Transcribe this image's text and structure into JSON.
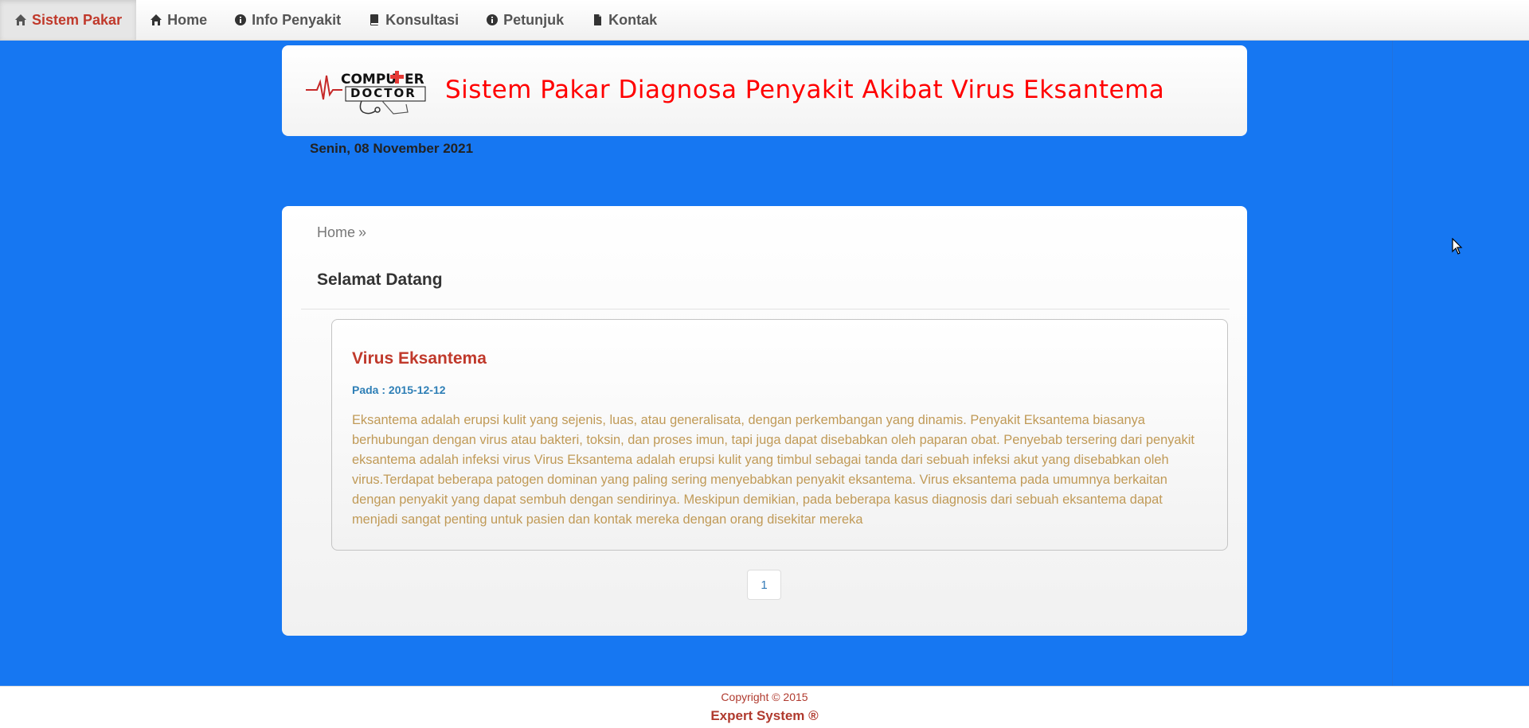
{
  "nav": {
    "brand": {
      "label": "Sistem Pakar",
      "icon": "home-icon"
    },
    "items": [
      {
        "label": "Home",
        "icon": "home-icon"
      },
      {
        "label": "Info Penyakit",
        "icon": "info-circle-icon"
      },
      {
        "label": "Konsultasi",
        "icon": "book-icon"
      },
      {
        "label": "Petunjuk",
        "icon": "info-circle-icon"
      },
      {
        "label": "Kontak",
        "icon": "file-icon"
      }
    ]
  },
  "header": {
    "logo_text": "COMPUTER DOCTOR",
    "title": "Sistem Pakar Diagnosa Penyakit Akibat Virus Eksantema"
  },
  "date": "Senin, 08 November 2021",
  "main": {
    "breadcrumb": {
      "home": "Home",
      "separator": "»"
    },
    "page_title": "Selamat Datang",
    "article": {
      "title": "Virus Eksantema",
      "date": "Pada : 2015-12-12",
      "body": "Eksantema adalah erupsi kulit yang sejenis, luas, atau generalisata, dengan perkembangan yang dinamis. Penyakit Eksantema biasanya berhubungan dengan virus atau bakteri, toksin, dan proses imun, tapi juga dapat disebabkan oleh paparan obat. Penyebab tersering dari penyakit eksantema adalah infeksi virus Virus Eksantema adalah erupsi kulit yang timbul sebagai tanda dari sebuah infeksi akut yang disebabkan oleh virus.Terdapat beberapa patogen dominan yang paling sering menyebabkan penyakit eksantema. Virus eksantema pada umumnya berkaitan dengan penyakit yang dapat sembuh dengan sendirinya. Meskipun demikian, pada beberapa kasus diagnosis dari sebuah eksantema dapat menjadi sangat penting untuk pasien dan kontak mereka dengan orang disekitar mereka"
    },
    "pagination": {
      "current_page": "1"
    }
  },
  "footer": {
    "copyright": "Copyright © 2015",
    "brand": "Expert System ®"
  },
  "colors": {
    "background": "#1677f2",
    "brand_red": "#c0392b",
    "title_red": "#ff0000",
    "date_blue": "#2e7fb6",
    "body_text": "#c09a57"
  }
}
